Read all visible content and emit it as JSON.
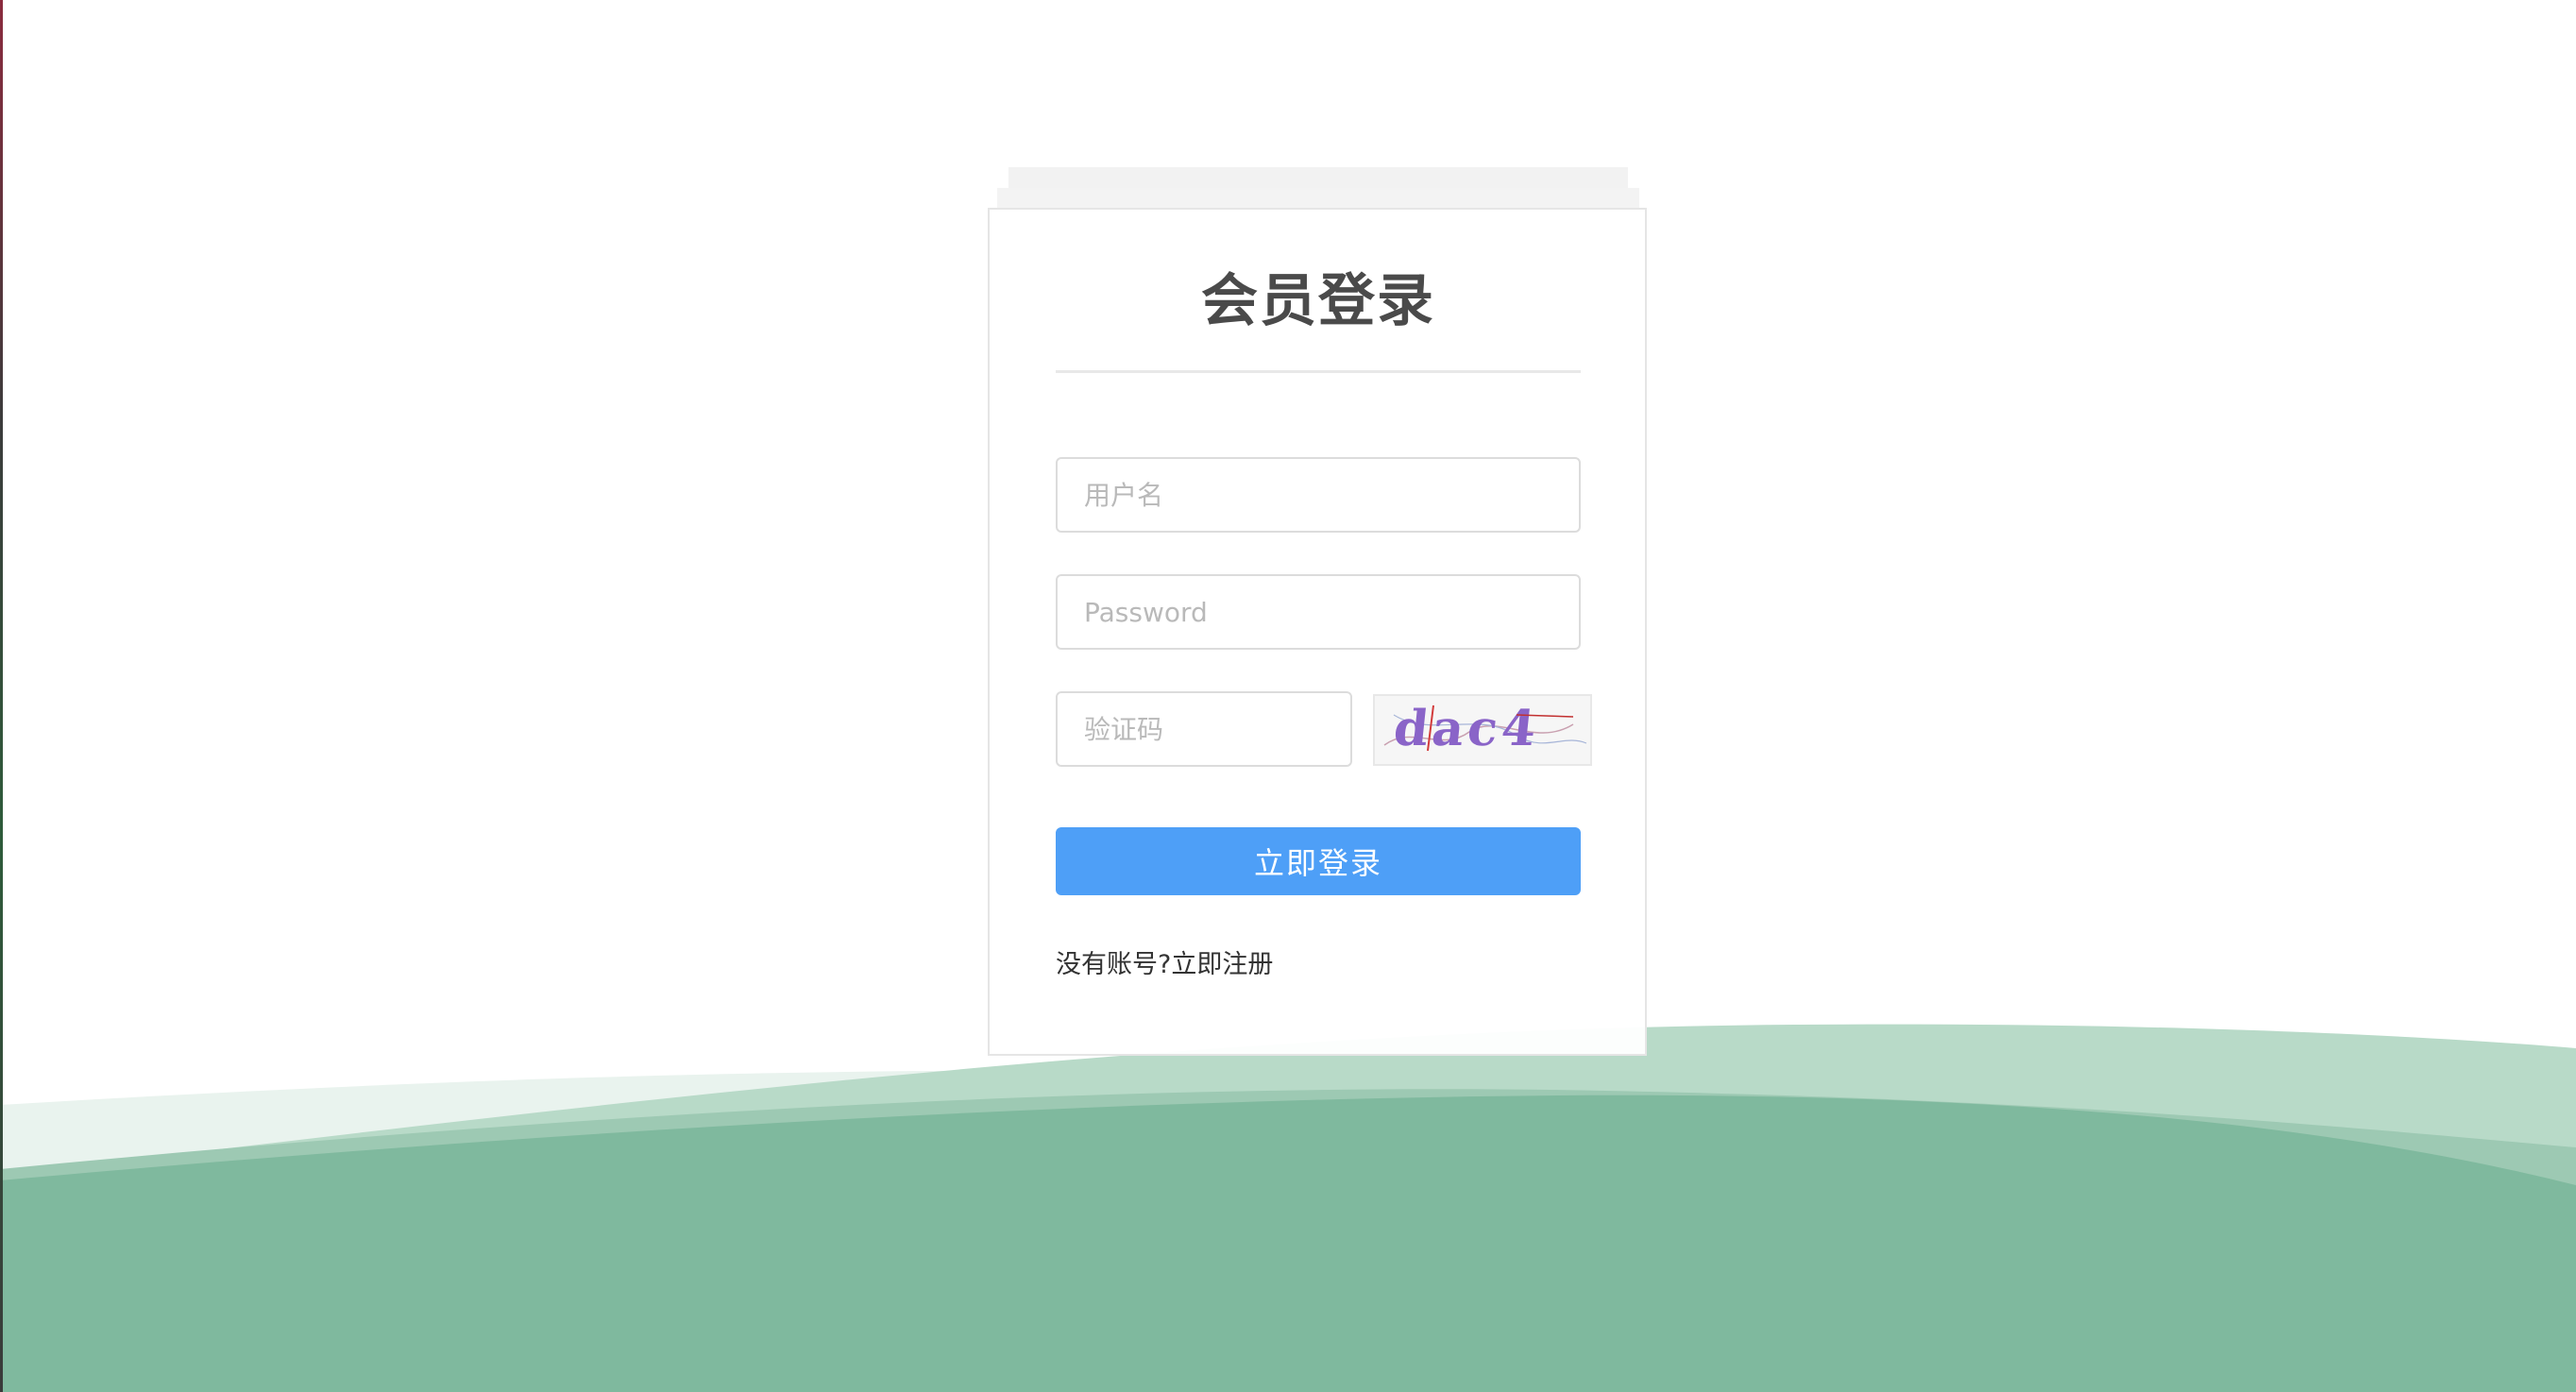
{
  "page": {
    "title": "会员登录"
  },
  "form": {
    "username_placeholder": "用户名",
    "password_placeholder": "Password",
    "captcha_placeholder": "验证码",
    "captcha_text": "dac4",
    "submit_label": "立即登录",
    "no_account_text": "没有账号?",
    "register_label": "立即注册"
  },
  "colors": {
    "accent": "#4e9ff7",
    "wave_light": "#b8dac8",
    "wave_mid": "#9ccab4",
    "wave_dark": "#7fb99e",
    "wave_pale": "#e9f3ee"
  }
}
